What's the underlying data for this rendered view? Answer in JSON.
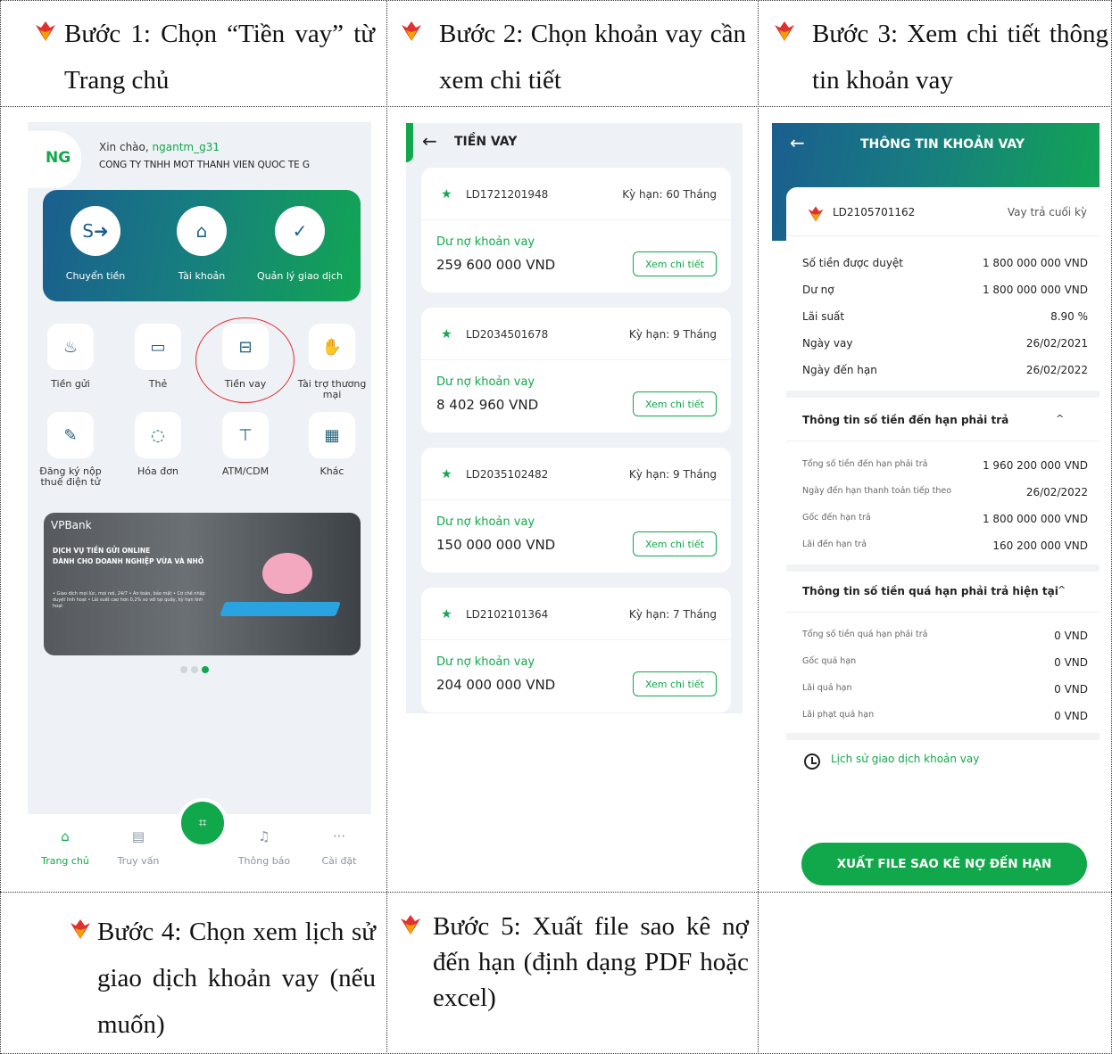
{
  "steps": {
    "s1": "Bước 1: Chọn “Tiền vay” từ Trang chủ",
    "s2": "Bước 2: Chọn khoản vay cần xem chi tiết",
    "s3": "Bước 3: Xem chi tiết thông tin khoản vay",
    "s4": "Bước 4: Chọn xem lịch sử giao dịch khoản vay (nếu muốn)",
    "s5": "Bước 5: Xuất file sao kê nợ đến hạn (định dạng PDF hoặc excel)"
  },
  "home": {
    "avatar": "NG",
    "greeting": "Xin chào, ",
    "username": "ngantm_g31",
    "company": "CONG TY TNHH MOT THANH VIEN QUOC TE G",
    "quick": [
      "Chuyển tiền",
      "Tài khoản",
      "Quản lý giao dịch"
    ],
    "services": [
      "Tiền gửi",
      "Thẻ",
      "Tiền vay",
      "Tài trợ thương mại",
      "Đăng ký nộp thuế điện tử",
      "Hóa đơn",
      "ATM/CDM",
      "Khác"
    ],
    "banner": {
      "brand": "VPBank",
      "line1": "DỊCH VỤ TIỀN GỬI ONLINE",
      "line2": "DÀNH CHO DOANH NGHIỆP VỪA VÀ NHỎ",
      "note": "• Giao dịch mọi lúc, mọi nơi, 24/7 • An toàn, bảo mật • Cơ chế nhập duyệt linh hoạt • Lãi suất cao hơn 0,2% so với tại quầy, kỳ hạn linh hoạt"
    },
    "nav": [
      "Trang chủ",
      "Truy vấn",
      "Thông báo",
      "Cài đặt"
    ]
  },
  "loans": {
    "title": "TIỀN VAY",
    "debt_label": "Dư nợ khoản vay",
    "detail_button": "Xem chi tiết",
    "items": [
      {
        "id": "LD1721201948",
        "term": "Kỳ hạn: 60 Tháng",
        "amount": "259 600 000 VND"
      },
      {
        "id": "LD2034501678",
        "term": "Kỳ hạn: 9 Tháng",
        "amount": "8 402 960 VND"
      },
      {
        "id": "LD2035102482",
        "term": "Kỳ hạn: 9 Tháng",
        "amount": "150 000 000 VND"
      },
      {
        "id": "LD2102101364",
        "term": "Kỳ hạn: 7 Tháng",
        "amount": "204 000 000 VND"
      }
    ]
  },
  "detail": {
    "title": "THÔNG TIN KHOẢN VAY",
    "loan_id": "LD2105701162",
    "loan_type": "Vay trả cuối kỳ",
    "rows": [
      {
        "label": "Số tiền được duyệt",
        "value": "1 800 000 000 VND"
      },
      {
        "label": "Dư nợ",
        "value": "1 800 000 000 VND"
      },
      {
        "label": "Lãi suất",
        "value": "8.90 %"
      },
      {
        "label": "Ngày vay",
        "value": "26/02/2021"
      },
      {
        "label": "Ngày đến hạn",
        "value": "26/02/2022"
      }
    ],
    "due_title": "Thông tin số tiền đến hạn phải trả",
    "due_rows": [
      {
        "label": "Tổng số tiền đến hạn phải trả",
        "value": "1 960 200 000 VND"
      },
      {
        "label": "Ngày đến hạn thanh toán tiếp theo",
        "value": "26/02/2022"
      },
      {
        "label": "Gốc đến hạn trả",
        "value": "1 800 000 000 VND"
      },
      {
        "label": "Lãi đến hạn trả",
        "value": "160 200 000 VND"
      }
    ],
    "overdue_title": "Thông tin số tiền quá hạn phải trả hiện tại",
    "overdue_rows": [
      {
        "label": "Tổng số tiền quá hạn phải trả",
        "value": "0 VND"
      },
      {
        "label": "Gốc quá hạn",
        "value": "0 VND"
      },
      {
        "label": "Lãi quá hạn",
        "value": "0 VND"
      },
      {
        "label": "Lãi phạt quá hạn",
        "value": "0 VND"
      }
    ],
    "history": "Lịch sử giao dịch khoản vay",
    "export": "XUẤT FILE SAO KÊ NỢ ĐẾN HẠN"
  }
}
